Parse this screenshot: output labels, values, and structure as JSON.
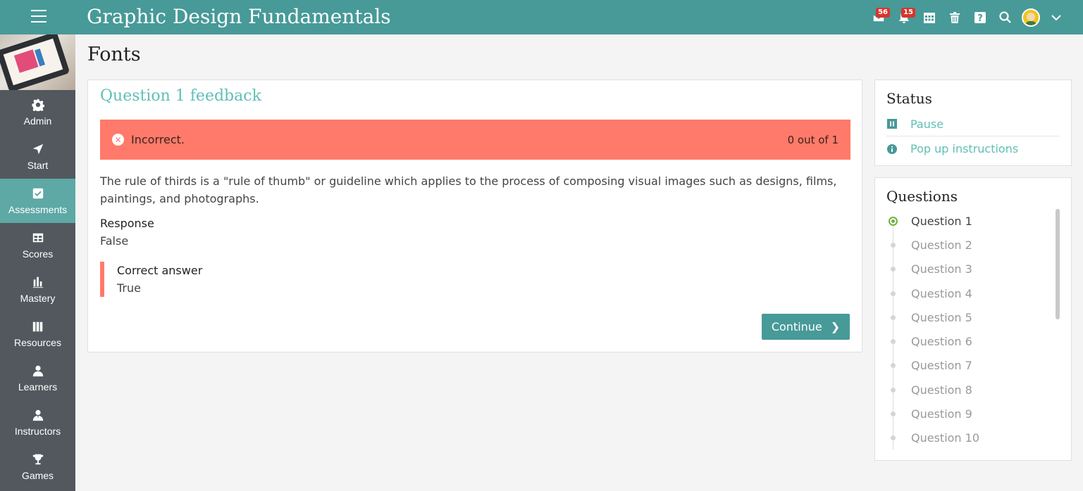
{
  "header": {
    "title": "Graphic Design Fundamentals",
    "mail_badge": "56",
    "notifications_badge": "15"
  },
  "sidebar": {
    "items": [
      {
        "label": "Admin",
        "icon": "gear-icon"
      },
      {
        "label": "Start",
        "icon": "paper-plane-icon"
      },
      {
        "label": "Assessments",
        "icon": "checkbox-icon",
        "active": true
      },
      {
        "label": "Scores",
        "icon": "table-icon"
      },
      {
        "label": "Mastery",
        "icon": "bar-chart-icon"
      },
      {
        "label": "Resources",
        "icon": "books-icon"
      },
      {
        "label": "Learners",
        "icon": "person-icon"
      },
      {
        "label": "Instructors",
        "icon": "instructor-icon"
      },
      {
        "label": "Games",
        "icon": "trophy-icon"
      }
    ]
  },
  "page": {
    "title": "Fonts"
  },
  "feedback": {
    "title": "Question 1 feedback",
    "result": "Incorrect.",
    "score": "0 out of 1",
    "explanation": "The rule of thirds is a \"rule of thumb\" or guideline which applies to the process of composing visual images such as designs, films, paintings, and photographs.",
    "response_label": "Response",
    "response_value": "False",
    "correct_label": "Correct answer",
    "correct_value": "True",
    "continue_label": "Continue"
  },
  "status": {
    "title": "Status",
    "pause_label": "Pause",
    "instructions_label": "Pop up instructions"
  },
  "questions": {
    "title": "Questions",
    "items": [
      "Question 1",
      "Question 2",
      "Question 3",
      "Question 4",
      "Question 5",
      "Question 6",
      "Question 7",
      "Question 8",
      "Question 9",
      "Question 10"
    ],
    "current": "Question 1"
  },
  "colors": {
    "topbar": "#479a98",
    "sidebar": "#52585e",
    "active_nav": "#5ea8a5",
    "alert": "#ff7a6a",
    "accent_text": "#5fbfb6"
  }
}
